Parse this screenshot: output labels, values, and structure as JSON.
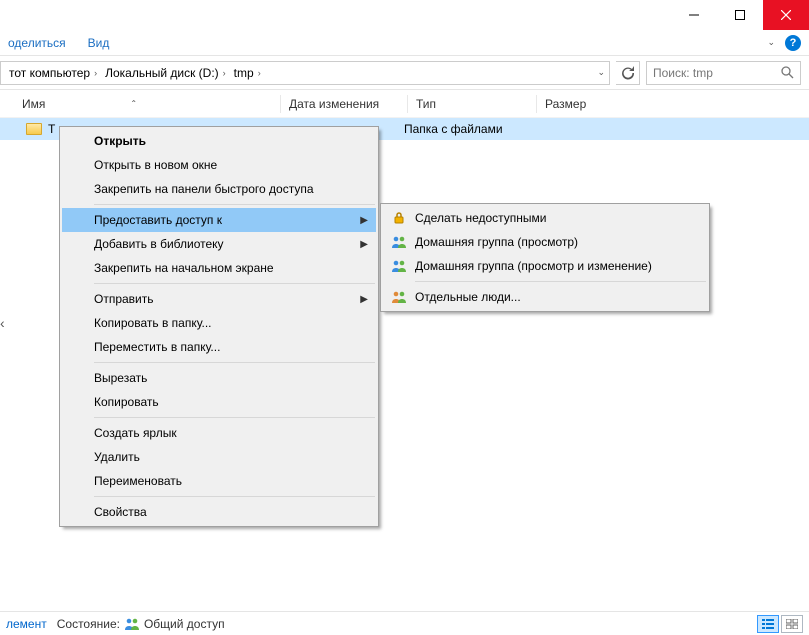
{
  "ribbon": {
    "share": "оделиться",
    "view": "Вид"
  },
  "breadcrumb": {
    "c0": "тот компьютер",
    "c1": "Локальный диск (D:)",
    "c2": "tmp"
  },
  "search": {
    "placeholder": "Поиск: tmp"
  },
  "cols": {
    "name": "Имя",
    "date": "Дата изменения",
    "type": "Тип",
    "size": "Размер"
  },
  "row": {
    "name": "T",
    "type": "Папка с файлами"
  },
  "menu1": {
    "open": "Открыть",
    "openNew": "Открыть в новом окне",
    "pinQuick": "Закрепить на панели быстрого доступа",
    "shareWith": "Предоставить доступ к",
    "addLib": "Добавить в библиотеку",
    "pinStart": "Закрепить на начальном экране",
    "sendTo": "Отправить",
    "copyTo": "Копировать в папку...",
    "moveTo": "Переместить в папку...",
    "cut": "Вырезать",
    "copy": "Копировать",
    "shortcut": "Создать ярлык",
    "delete": "Удалить",
    "rename": "Переименовать",
    "props": "Свойства"
  },
  "menu2": {
    "stop": "Сделать недоступными",
    "hgView": "Домашняя группа (просмотр)",
    "hgEdit": "Домашняя группа (просмотр и изменение)",
    "people": "Отдельные люди..."
  },
  "status": {
    "elem": "лемент",
    "stateLabel": "Состояние:",
    "state": "Общий доступ"
  }
}
